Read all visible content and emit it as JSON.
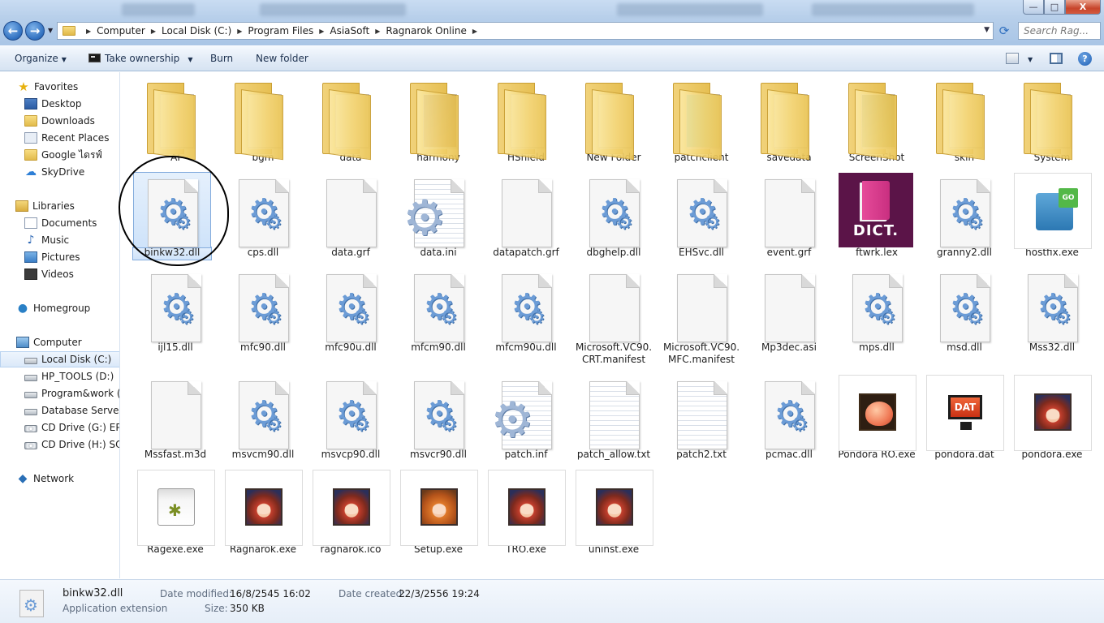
{
  "breadcrumb": [
    "Computer",
    "Local Disk (C:)",
    "Program Files",
    "AsiaSoft",
    "Ragnarok Online"
  ],
  "search": {
    "placeholder": "Search Rag..."
  },
  "window_buttons": {
    "minimize": "—",
    "maximize": "□",
    "close": "X"
  },
  "nav_icons": {
    "back": "←",
    "forward": "→",
    "refresh": "⟳"
  },
  "toolbar": {
    "organize": "Organize",
    "take_ownership": "Take ownership",
    "burn": "Burn",
    "new_folder": "New folder"
  },
  "sidebar": {
    "favorites": "Favorites",
    "desktop": "Desktop",
    "downloads": "Downloads",
    "recent_places": "Recent Places",
    "google_drive": "Google ไดรฟ์",
    "skydrive": "SkyDrive",
    "libraries": "Libraries",
    "documents": "Documents",
    "music": "Music",
    "pictures": "Pictures",
    "videos": "Videos",
    "homegroup": "Homegroup",
    "computer": "Computer",
    "local_disk_c": "Local Disk (C:)",
    "hp_tools_d": "HP_TOOLS (D:)",
    "program_work": "Program&work (E",
    "database_server": "Database Server al",
    "cd_drive_g": "CD Drive (G:) EPSC",
    "cd_drive_h": "CD Drive (H:) SQLI",
    "network": "Network"
  },
  "files": {
    "r1": [
      "AI",
      "bgm",
      "data",
      "harmony",
      "HShield",
      "New Folder",
      "patchclient",
      "savedata",
      "ScreenShot",
      "skin",
      "System"
    ],
    "r2": [
      "binkw32.dll",
      "cps.dll",
      "data.grf",
      "data.ini",
      "datapatch.grf",
      "dbghelp.dll",
      "EHSvc.dll",
      "event.grf",
      "ftwrk.lex",
      "granny2.dll",
      "hostfix.exe"
    ],
    "r3": [
      "ijl15.dll",
      "mfc90.dll",
      "mfc90u.dll",
      "mfcm90.dll",
      "mfcm90u.dll",
      "Microsoft.VC90.CRT.manifest",
      "Microsoft.VC90.MFC.manifest",
      "Mp3dec.asi",
      "mps.dll",
      "msd.dll",
      "Mss32.dll"
    ],
    "r4": [
      "Mssfast.m3d",
      "msvcm90.dll",
      "msvcp90.dll",
      "msvcr90.dll",
      "patch.inf",
      "patch_allow.txt",
      "patch2.txt",
      "pcmac.dll",
      "Pondora RO.exe",
      "pondora.dat",
      "pondora.exe"
    ],
    "r5": [
      "Ragexe.exe",
      "Ragnarok.exe",
      "ragnarok.ico",
      "Setup.exe",
      "TRO.exe",
      "uninst.exe"
    ]
  },
  "icon_text": {
    "dict": "DICT.",
    "dat": "DAT"
  },
  "details": {
    "filename": "binkw32.dll",
    "type": "Application extension",
    "date_modified_label": "Date modified:",
    "date_modified": "16/8/2545 16:02",
    "size_label": "Size:",
    "size": "350 KB",
    "date_created_label": "Date created:",
    "date_created": "22/3/2556 19:24"
  }
}
